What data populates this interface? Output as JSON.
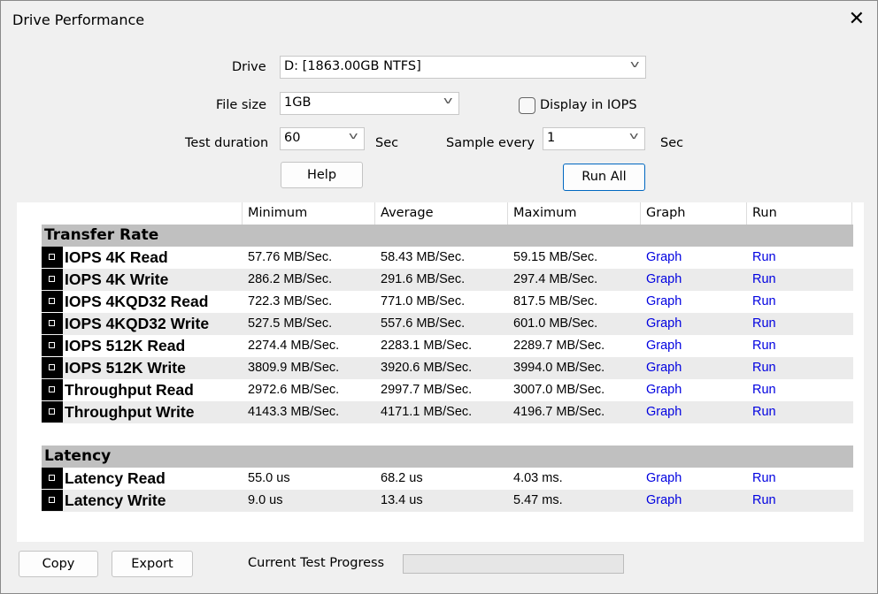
{
  "window": {
    "title": "Drive Performance"
  },
  "form": {
    "drive_label": "Drive",
    "drive_value": "D: [1863.00GB NTFS]",
    "file_size_label": "File size",
    "file_size_value": "1GB",
    "display_iops_label": "Display in IOPS",
    "display_iops_checked": false,
    "test_duration_label": "Test duration",
    "test_duration_value": "60",
    "test_duration_unit": "Sec",
    "sample_every_label": "Sample every",
    "sample_every_value": "1",
    "sample_every_unit": "Sec",
    "help_label": "Help",
    "run_all_label": "Run All"
  },
  "table": {
    "headers": [
      "Minimum",
      "Average",
      "Maximum",
      "Graph",
      "Run"
    ],
    "sections": [
      {
        "title": "Transfer Rate",
        "rows": [
          {
            "name": "IOPS 4K Read",
            "min": "57.76 MB/Sec.",
            "avg": "58.43 MB/Sec.",
            "max": "59.15 MB/Sec.",
            "graph": "Graph",
            "run": "Run"
          },
          {
            "name": "IOPS 4K Write",
            "min": "286.2 MB/Sec.",
            "avg": "291.6 MB/Sec.",
            "max": "297.4 MB/Sec.",
            "graph": "Graph",
            "run": "Run"
          },
          {
            "name": "IOPS 4KQD32 Read",
            "min": "722.3 MB/Sec.",
            "avg": "771.0 MB/Sec.",
            "max": "817.5 MB/Sec.",
            "graph": "Graph",
            "run": "Run"
          },
          {
            "name": "IOPS 4KQD32 Write",
            "min": "527.5 MB/Sec.",
            "avg": "557.6 MB/Sec.",
            "max": "601.0 MB/Sec.",
            "graph": "Graph",
            "run": "Run"
          },
          {
            "name": "IOPS 512K Read",
            "min": "2274.4 MB/Sec.",
            "avg": "2283.1 MB/Sec.",
            "max": "2289.7 MB/Sec.",
            "graph": "Graph",
            "run": "Run"
          },
          {
            "name": "IOPS 512K Write",
            "min": "3809.9 MB/Sec.",
            "avg": "3920.6 MB/Sec.",
            "max": "3994.0 MB/Sec.",
            "graph": "Graph",
            "run": "Run"
          },
          {
            "name": "Throughput Read",
            "min": "2972.6 MB/Sec.",
            "avg": "2997.7 MB/Sec.",
            "max": "3007.0 MB/Sec.",
            "graph": "Graph",
            "run": "Run"
          },
          {
            "name": "Throughput Write",
            "min": "4143.3 MB/Sec.",
            "avg": "4171.1 MB/Sec.",
            "max": "4196.7 MB/Sec.",
            "graph": "Graph",
            "run": "Run"
          }
        ]
      },
      {
        "title": "Latency",
        "rows": [
          {
            "name": "Latency Read",
            "min": "55.0 us",
            "avg": "68.2 us",
            "max": "4.03 ms.",
            "graph": "Graph",
            "run": "Run"
          },
          {
            "name": "Latency Write",
            "min": "9.0 us",
            "avg": "13.4 us",
            "max": "5.47 ms.",
            "graph": "Graph",
            "run": "Run"
          }
        ]
      }
    ]
  },
  "footer": {
    "copy_label": "Copy",
    "export_label": "Export",
    "progress_label": "Current Test Progress",
    "progress_value": 0
  },
  "colors": {
    "link": "#0000e0",
    "section_bg": "#c0c0c0",
    "alt_row": "#ebebeb",
    "accent": "#0067c0"
  }
}
